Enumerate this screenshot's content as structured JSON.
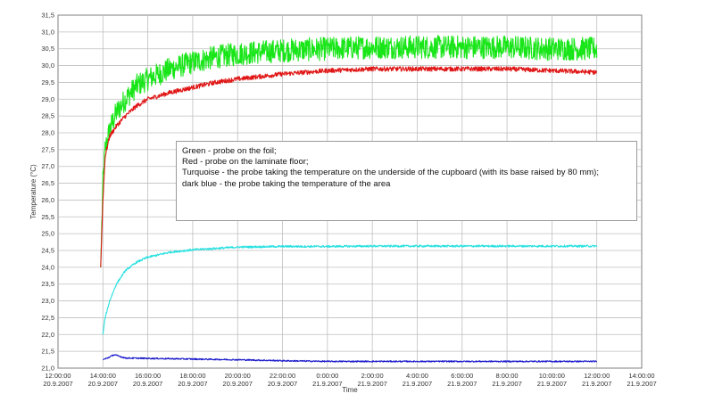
{
  "chart_data": {
    "type": "line",
    "title": "",
    "xlabel": "Time",
    "ylabel": "Temperature (°C)",
    "ylim": [
      21.0,
      31.5
    ],
    "y_ticks": [
      "21,0",
      "21,5",
      "22,0",
      "22,5",
      "23,0",
      "23,5",
      "24,0",
      "24,5",
      "25,0",
      "25,5",
      "26,0",
      "26,5",
      "27,0",
      "27,5",
      "28,0",
      "28,5",
      "29,0",
      "29,5",
      "30,0",
      "30,5",
      "31,0",
      "31,5"
    ],
    "xlim_hours": [
      0,
      26
    ],
    "x_ticks": [
      {
        "time": "12:00:00",
        "date": "20.9.2007"
      },
      {
        "time": "14:00:00",
        "date": "20.9.2007"
      },
      {
        "time": "16:00:00",
        "date": "20.9.2007"
      },
      {
        "time": "18:00:00",
        "date": "20.9.2007"
      },
      {
        "time": "20:00:00",
        "date": "20.9.2007"
      },
      {
        "time": "22:00:00",
        "date": "20.9.2007"
      },
      {
        "time": "0:00:00",
        "date": "21.9.2007"
      },
      {
        "time": "2:00:00",
        "date": "21.9.2007"
      },
      {
        "time": "4:00:00",
        "date": "21.9.2007"
      },
      {
        "time": "6:00:00",
        "date": "21.9.2007"
      },
      {
        "time": "8:00:00",
        "date": "21.9.2007"
      },
      {
        "time": "10:00:00",
        "date": "21.9.2007"
      },
      {
        "time": "12:00:00",
        "date": "21.9.2007"
      },
      {
        "time": "14:00:00",
        "date": "21.9.2007"
      }
    ],
    "grid": true,
    "series": [
      {
        "key": "green",
        "color": "#19e619",
        "x": [
          1.9,
          2.0,
          2.1,
          2.3,
          2.6,
          3.0,
          3.5,
          4.0,
          5.0,
          6.0,
          7.0,
          8.0,
          10.0,
          12.0,
          14.0,
          16.0,
          18.0,
          20.0,
          22.0,
          24.0
        ],
        "y": [
          24.0,
          26.5,
          27.5,
          28.1,
          28.6,
          29.0,
          29.4,
          29.6,
          29.9,
          30.1,
          30.25,
          30.35,
          30.45,
          30.5,
          30.55,
          30.55,
          30.55,
          30.55,
          30.5,
          30.5
        ],
        "noise": 0.35
      },
      {
        "key": "red",
        "color": "#e01515",
        "x": [
          1.9,
          2.0,
          2.1,
          2.3,
          2.6,
          3.0,
          3.5,
          4.0,
          5.0,
          6.0,
          7.0,
          8.0,
          10.0,
          12.0,
          14.0,
          16.0,
          18.0,
          20.0,
          22.0,
          24.0
        ],
        "y": [
          24.0,
          26.0,
          27.3,
          27.9,
          28.2,
          28.5,
          28.8,
          29.0,
          29.2,
          29.35,
          29.5,
          29.6,
          29.75,
          29.85,
          29.9,
          29.9,
          29.9,
          29.9,
          29.85,
          29.8
        ],
        "noise": 0.07
      },
      {
        "key": "turquoise",
        "color": "#27e0e0",
        "x": [
          2.0,
          2.1,
          2.3,
          2.6,
          3.0,
          3.5,
          4.0,
          5.0,
          6.0,
          7.0,
          8.0,
          10.0,
          12.0,
          14.0,
          16.0,
          18.0,
          20.0,
          22.0,
          24.0
        ],
        "y": [
          22.0,
          22.5,
          23.0,
          23.5,
          23.9,
          24.15,
          24.3,
          24.45,
          24.52,
          24.56,
          24.6,
          24.62,
          24.62,
          24.63,
          24.63,
          24.63,
          24.63,
          24.63,
          24.63
        ],
        "noise": 0.03
      },
      {
        "key": "dark-blue",
        "color": "#1b1bcc",
        "x": [
          2.0,
          2.2,
          2.5,
          3.0,
          5.0,
          8.0,
          10.0,
          12.0,
          14.0,
          16.0,
          18.0,
          20.0,
          22.0,
          24.0
        ],
        "y": [
          21.25,
          21.3,
          21.4,
          21.3,
          21.28,
          21.25,
          21.22,
          21.2,
          21.2,
          21.2,
          21.2,
          21.2,
          21.2,
          21.2
        ],
        "noise": 0.02
      }
    ],
    "legend": [
      "Green - probe on the foil;",
      "Red - probe on the laminate floor;",
      "Turquoise - the probe taking the temperature on the underside of the cupboard (with its base raised by 80 mm);",
      "dark blue - the probe taking the temperature of the area"
    ]
  }
}
